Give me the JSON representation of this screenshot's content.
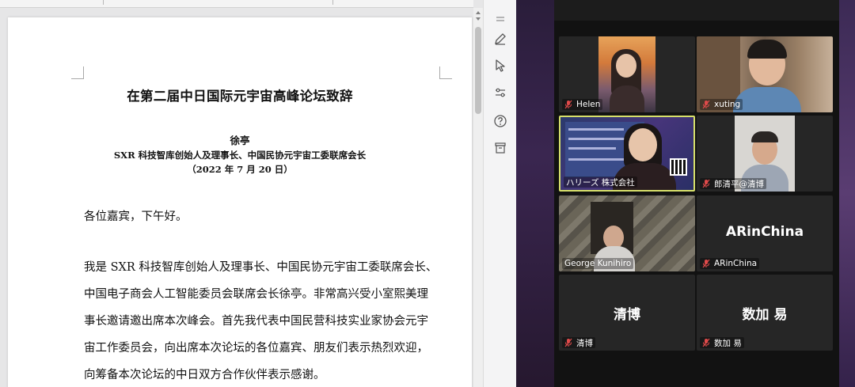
{
  "document": {
    "title": "在第二届中日国际元宇宙高峰论坛致辞",
    "author": "徐亭",
    "role": "SXR 科技智库创始人及理事长、中国民协元宇宙工委联席会长",
    "date": "（2022 年 7 月 20 日）",
    "greeting": "各位嘉宾，下午好。",
    "paragraph_lines": [
      "我是 SXR 科技智库创始人及理事长、中国民协元宇宙工委联席会长、",
      "中国电子商会人工智能委员会联席会长徐亭。非常高兴受小室熙美理",
      "事长邀请邀出席本次峰会。首先我代表中国民营科技实业家协会元宇",
      "宙工作委员会，向出席本次论坛的各位嘉宾、朋友们表示热烈欢迎，",
      "向筹备本次论坛的中日双方合作伙伴表示感谢。"
    ]
  },
  "tools": [
    {
      "icon": "pen-icon"
    },
    {
      "icon": "cursor-icon"
    },
    {
      "icon": "sliders-icon"
    },
    {
      "icon": "help-icon"
    },
    {
      "icon": "archive-icon"
    }
  ],
  "participants": [
    {
      "name": "Helen",
      "video": true,
      "muted": true
    },
    {
      "name": "xuting",
      "video": true,
      "muted": true
    },
    {
      "name": "ハリーズ 株式会社",
      "video": true,
      "muted": false,
      "active": true
    },
    {
      "name": "郎清平@清博",
      "video": true,
      "muted": true
    },
    {
      "name": "George Kunihiro",
      "video": true,
      "muted": false
    },
    {
      "name": "ARinChina",
      "display": "ARinChina",
      "video": false,
      "muted": true
    },
    {
      "name": "清博",
      "display": "清博",
      "video": false,
      "muted": true
    },
    {
      "name": "数加 易",
      "display": "数加 易",
      "video": false,
      "muted": true
    }
  ],
  "colors": {
    "active_speaker_border": "#d7e06a",
    "muted_icon": "#e04a4a",
    "tile_bg": "#262626"
  }
}
